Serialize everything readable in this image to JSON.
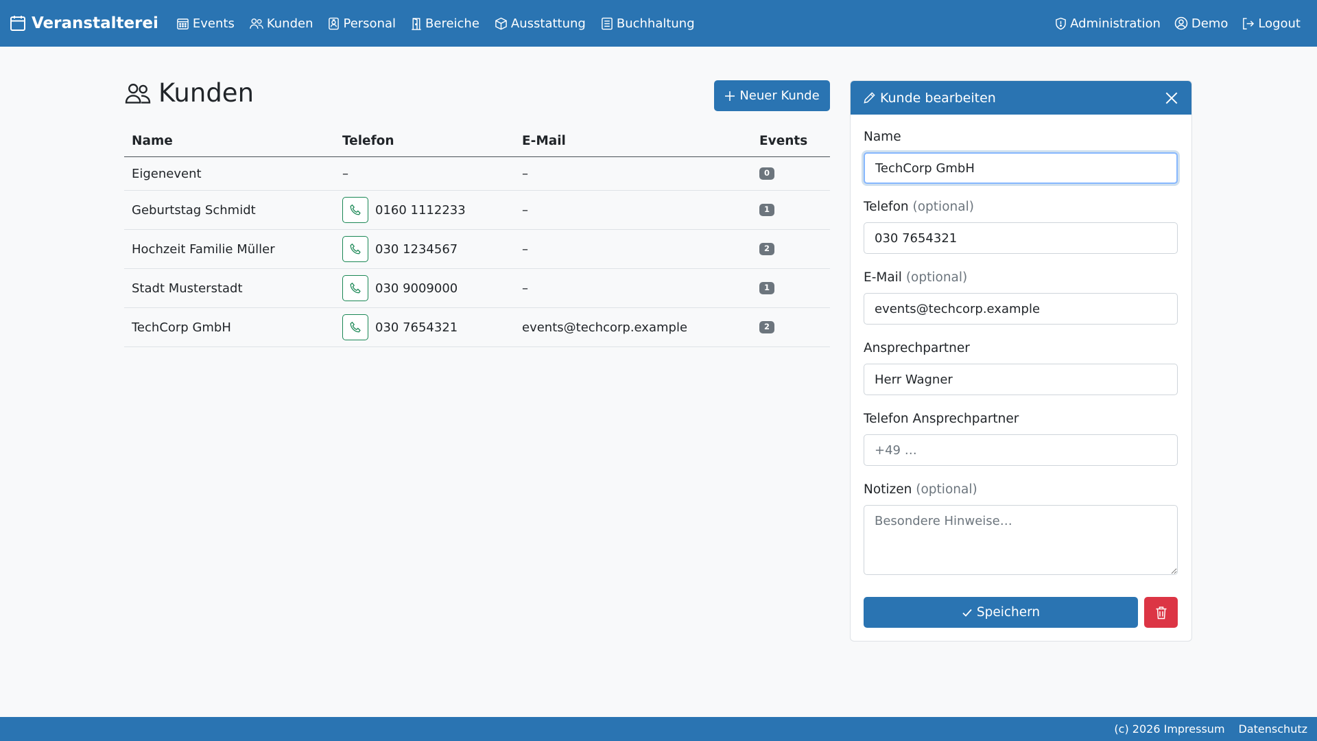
{
  "app": {
    "brand": "Veranstalterei"
  },
  "nav": {
    "items": [
      "Events",
      "Kunden",
      "Personal",
      "Bereiche",
      "Ausstattung",
      "Buchhaltung"
    ],
    "right": [
      "Administration",
      "Demo",
      "Logout"
    ]
  },
  "page": {
    "title": "Kunden",
    "new_button": "Neuer Kunde"
  },
  "table": {
    "headers": [
      "Name",
      "Telefon",
      "E-Mail",
      "Events"
    ],
    "rows": [
      {
        "name": "Eigenevent",
        "phone": "–",
        "email": "–",
        "events": "0"
      },
      {
        "name": "Geburtstag Schmidt",
        "phone": "0160 1112233",
        "email": "–",
        "events": "1"
      },
      {
        "name": "Hochzeit Familie Müller",
        "phone": "030 1234567",
        "email": "–",
        "events": "2"
      },
      {
        "name": "Stadt Musterstadt",
        "phone": "030 9009000",
        "email": "–",
        "events": "1"
      },
      {
        "name": "TechCorp GmbH",
        "phone": "030 7654321",
        "email": "events@techcorp.example",
        "events": "2"
      }
    ]
  },
  "panel": {
    "title": "Kunde bearbeiten",
    "optional": "(optional)",
    "fields": {
      "name": {
        "label": "Name",
        "value": "TechCorp GmbH"
      },
      "phone": {
        "label": "Telefon",
        "value": "030 7654321"
      },
      "email": {
        "label": "E-Mail",
        "value": "events@techcorp.example"
      },
      "contact": {
        "label": "Ansprechpartner",
        "value": "Herr Wagner"
      },
      "contact_phone": {
        "label": "Telefon Ansprechpartner",
        "placeholder": "+49 …"
      },
      "notes": {
        "label": "Notizen",
        "placeholder": "Besondere Hinweise…"
      }
    },
    "save_label": "Speichern"
  },
  "footer": {
    "impressum": "(c) 2026 Impressum",
    "datenschutz": "Datenschutz"
  },
  "colors": {
    "primary": "#2a74b2",
    "danger": "#dc3545",
    "success": "#198754",
    "badge": "#6c757d"
  }
}
